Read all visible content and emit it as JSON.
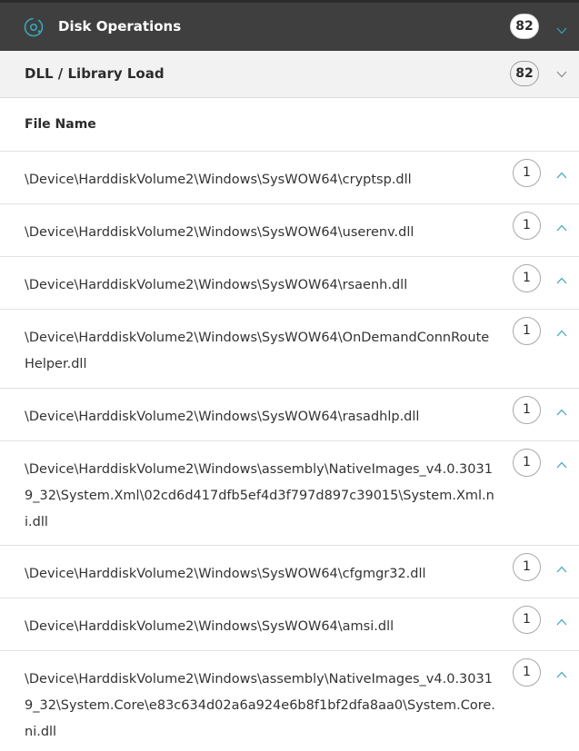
{
  "panel": {
    "title": "Disk Operations",
    "count": "82",
    "icon": "disk-operations-icon",
    "accent": "#3aa6b9"
  },
  "section": {
    "title": "DLL / Library Load",
    "count": "82"
  },
  "table": {
    "column_header": "File Name",
    "rows": [
      {
        "path": "\\Device\\HarddiskVolume2\\Windows\\SysWOW64\\cryptsp.dll",
        "count": "1"
      },
      {
        "path": "\\Device\\HarddiskVolume2\\Windows\\SysWOW64\\userenv.dll",
        "count": "1"
      },
      {
        "path": "\\Device\\HarddiskVolume2\\Windows\\SysWOW64\\rsaenh.dll",
        "count": "1"
      },
      {
        "path": "\\Device\\HarddiskVolume2\\Windows\\SysWOW64\\OnDemandConnRouteHelper.dll",
        "count": "1"
      },
      {
        "path": "\\Device\\HarddiskVolume2\\Windows\\SysWOW64\\rasadhlp.dll",
        "count": "1"
      },
      {
        "path": "\\Device\\HarddiskVolume2\\Windows\\assembly\\NativeImages_v4.0.30319_32\\System.Xml\\02cd6d417dfb5ef4d3f797d897c39015\\System.Xml.ni.dll",
        "count": "1"
      },
      {
        "path": "\\Device\\HarddiskVolume2\\Windows\\SysWOW64\\cfgmgr32.dll",
        "count": "1"
      },
      {
        "path": "\\Device\\HarddiskVolume2\\Windows\\SysWOW64\\amsi.dll",
        "count": "1"
      },
      {
        "path": "\\Device\\HarddiskVolume2\\Windows\\assembly\\NativeImages_v4.0.30319_32\\System.Core\\e83c634d02a6a924e6b8f1bf2dfa8aa0\\System.Core.ni.dll",
        "count": "1"
      }
    ]
  }
}
